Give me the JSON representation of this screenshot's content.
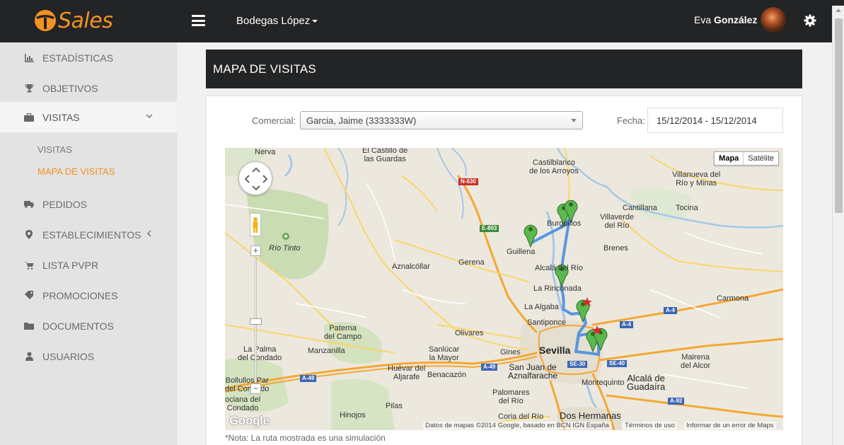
{
  "brand": {
    "name": "Sales",
    "accent": "#f39221"
  },
  "topbar": {
    "company": "Bodegas López",
    "user_first": "Eva",
    "user_last": "González"
  },
  "sidebar": {
    "items": [
      {
        "label": "ESTADÍSTICAS",
        "icon": "bar-chart-icon"
      },
      {
        "label": "OBJETIVOS",
        "icon": "trophy-icon"
      },
      {
        "label": "VISITAS",
        "icon": "briefcase-icon"
      },
      {
        "label": "PEDIDOS",
        "icon": "truck-icon"
      },
      {
        "label": "ESTABLECIMIENTOS",
        "icon": "map-marker-icon"
      },
      {
        "label": "LISTA PVPR",
        "icon": "cart-icon"
      },
      {
        "label": "PROMOCIONES",
        "icon": "tag-icon"
      },
      {
        "label": "DOCUMENTOS",
        "icon": "folder-icon"
      },
      {
        "label": "USUARIOS",
        "icon": "user-icon"
      }
    ],
    "sub_items": [
      "VISITAS",
      "MAPA DE VISITAS"
    ]
  },
  "main": {
    "title": "MAPA DE VISITAS",
    "comercial_label": "Comercial:",
    "comercial_value": "Garcia, Jaime (3333333W)",
    "fecha_label": "Fecha:",
    "fecha_value": "15/12/2014 - 15/12/2014",
    "note": "*Nota: La ruta mostrada es una simulación"
  },
  "map": {
    "type_buttons": [
      "Mapa",
      "Satélite"
    ],
    "places": {
      "nerva": "Nerva",
      "castillo": "El Castillo de\nlas Guardas",
      "castilblanco": "Castilblanco\nde los Arroyos",
      "villanueva": "Villanueva del\nRío y Minas",
      "cantillana": "Cantillana",
      "tocina": "Tocina",
      "burguillos": "Burguillos",
      "villaverde": "Villaverde\ndel Río",
      "guillena": "Guillena",
      "brenes": "Brenes",
      "riotinto": "Río Tinto",
      "aznalcollar": "Aznalcóllar",
      "gerena": "Gerena",
      "alcala_rio": "Alcalá del Río",
      "rinconada": "La Rinconada",
      "algaba": "La Algaba",
      "carmona": "Carmona",
      "santiponce": "Santiponce",
      "paterna": "Paterna\ndel Campo",
      "olivares": "Olivares",
      "la_palma": "La Palma\ndel Condado",
      "manzanilla": "Manzanilla",
      "sanlucar": "Sanlúcar\nla Mayor",
      "gines": "Gines",
      "sevilla": "Sevilla",
      "mairena": "Mairena\ndel Alcor",
      "bollullos": "Bollullos Par\ndel Condado",
      "huevar": "Huévar del\nAljarafe",
      "benacazon": "Benacazón",
      "san_juan": "San Juan de\nAznalfarache",
      "montequinto": "Montequinto",
      "alcala_guadaira": "Alcalá de\nGuadaíra",
      "rociana": "ociana del\nCondado",
      "pilas": "Pilas",
      "palomares": "Palomares\ndel Río",
      "coria": "Coria del Río",
      "dos_hermanas": "Dos Hermanas",
      "hinojos": "Hinojos"
    },
    "roads": {
      "n630": "N-630",
      "e803": "E-803",
      "a4a": "A-4",
      "a4b": "A-4",
      "a49a": "A-49",
      "a49b": "A-49",
      "se30": "SE-30",
      "se40": "SE-40",
      "a92": "A-92"
    },
    "attribution": "Datos de mapas ©2014 Google, basado en BCN IGN España",
    "terms": "Términos de uso",
    "report": "Informar de un error de Maps",
    "logo": "Google"
  }
}
